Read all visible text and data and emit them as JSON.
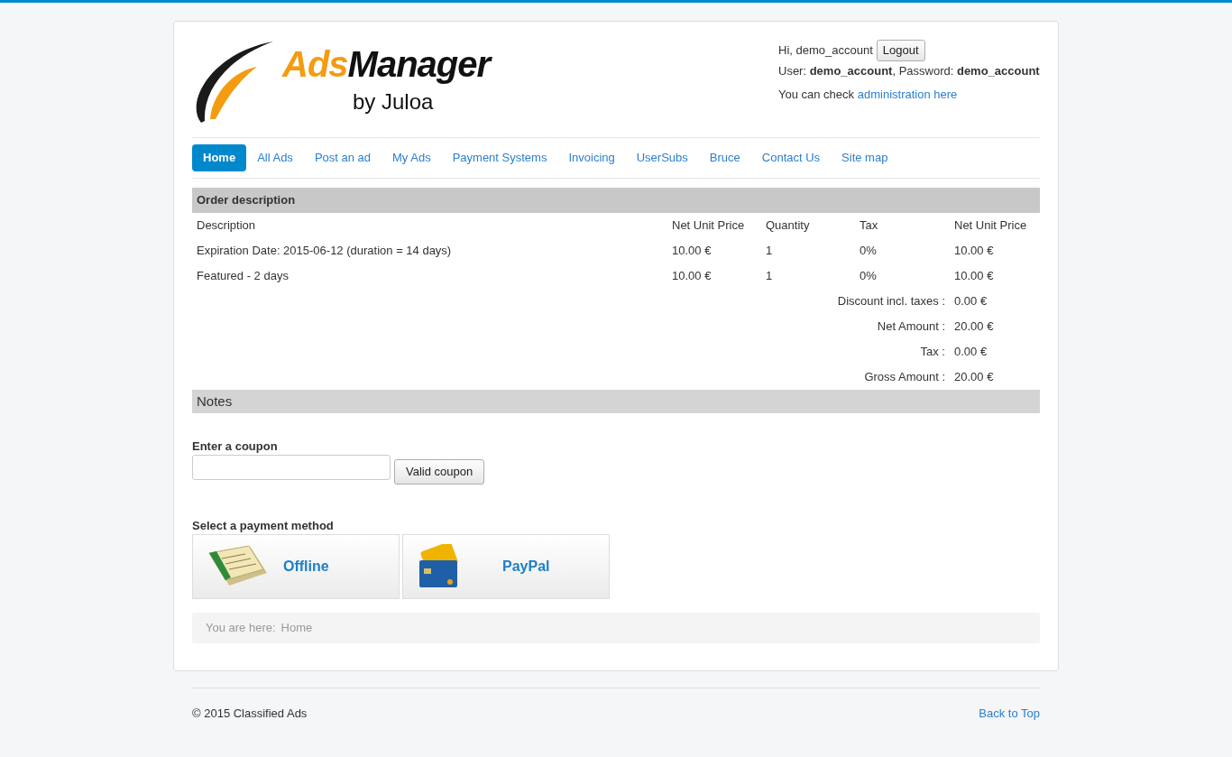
{
  "logo": {
    "brand_part1": "Ads",
    "brand_part2": "Manager",
    "tagline": "by Juloa"
  },
  "user_panel": {
    "greeting": "Hi, demo_account",
    "logout_button": "Logout",
    "credentials": "User: **demo_account**, Password: **demo_account**",
    "admin_prefix": "You can check",
    "admin_link": "administration here"
  },
  "nav": [
    {
      "label": "Home",
      "selected": true
    },
    {
      "label": "All Ads",
      "selected": false
    },
    {
      "label": "Post an ad",
      "selected": false
    },
    {
      "label": "My Ads",
      "selected": false
    },
    {
      "label": "Payment Systems",
      "selected": false
    },
    {
      "label": "Invoicing",
      "selected": false
    },
    {
      "label": "UserSubs",
      "selected": false
    },
    {
      "label": "Bruce",
      "selected": false
    },
    {
      "label": "Contact Us",
      "selected": false
    },
    {
      "label": "Site map",
      "selected": false
    }
  ],
  "order": {
    "title": "Order description",
    "columns": [
      "Description",
      "Net Unit Price",
      "Quantity",
      "Tax",
      "Net Unit Price"
    ],
    "rows": [
      [
        "Expiration Date: 2015-06-12 (duration = 14 days)",
        "10.00 €",
        "1",
        "0%",
        "10.00 €"
      ],
      [
        "Featured - 2 days",
        "10.00 €",
        "1",
        "0%",
        "10.00 €"
      ]
    ],
    "totals": [
      {
        "label": "Discount incl. taxes :",
        "value": "0.00 €"
      },
      {
        "label": "Net Amount :",
        "value": "20.00 €"
      },
      {
        "label": "Tax :",
        "value": "0.00 €"
      },
      {
        "label": "Gross Amount :",
        "value": "20.00 €"
      }
    ]
  },
  "notes": {
    "title": "Notes"
  },
  "coupon": {
    "label": "Enter a coupon",
    "button": "Valid coupon"
  },
  "payment": {
    "label": "Select a payment method",
    "methods": [
      {
        "kind": "cheque",
        "label": "Offline"
      },
      {
        "kind": "card",
        "label": "PayPal"
      }
    ]
  },
  "breadcrumb": {
    "prefix": "You are here:",
    "items": [
      "Home"
    ]
  },
  "footer": {
    "copyright": "© 2015 Classified Ads",
    "back_to_top": "Back to Top"
  }
}
